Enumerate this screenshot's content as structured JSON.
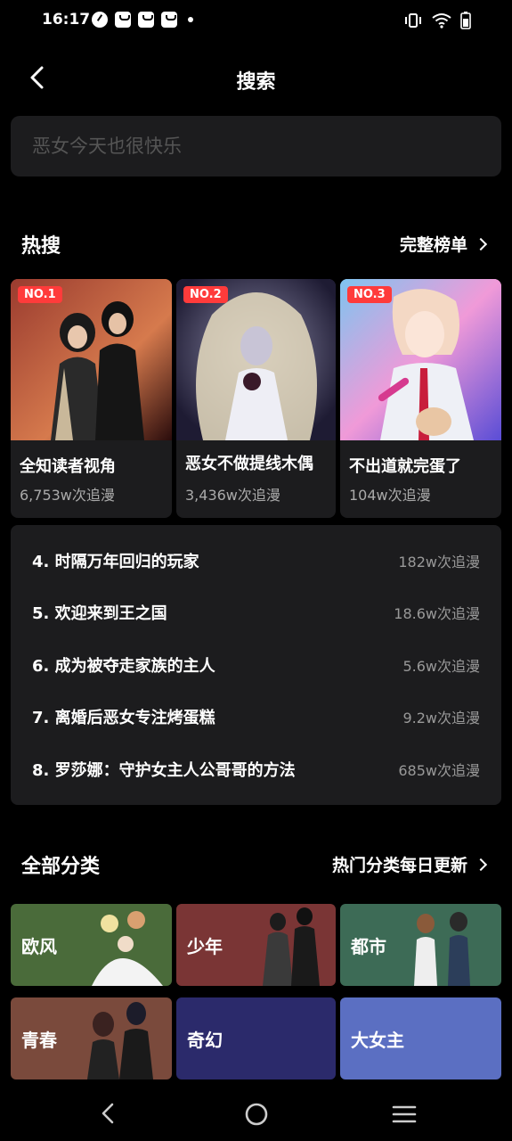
{
  "status": {
    "time": "16:17"
  },
  "header": {
    "title": "搜索"
  },
  "search": {
    "placeholder": "恶女今天也很快乐"
  },
  "hot": {
    "title": "热搜",
    "more": "完整榜单",
    "top": [
      {
        "rank": "NO.1",
        "name": "全知读者视角",
        "count": "6,753w次追漫"
      },
      {
        "rank": "NO.2",
        "name": "恶女不做提线木偶",
        "count": "3,436w次追漫"
      },
      {
        "rank": "NO.3",
        "name": "不出道就完蛋了",
        "count": "104w次追漫"
      }
    ],
    "list": [
      {
        "title": "4. 时隔万年回归的玩家",
        "count": "182w次追漫"
      },
      {
        "title": "5. 欢迎来到王之国",
        "count": "18.6w次追漫"
      },
      {
        "title": "6. 成为被夺走家族的主人",
        "count": "5.6w次追漫"
      },
      {
        "title": "7. 离婚后恶女专注烤蛋糕",
        "count": "9.2w次追漫"
      },
      {
        "title": "8. 罗莎娜：守护女主人公哥哥的方法",
        "count": "685w次追漫"
      }
    ]
  },
  "categories": {
    "title": "全部分类",
    "more": "热门分类每日更新",
    "items": [
      {
        "label": "欧风",
        "color": "#4a6b3a"
      },
      {
        "label": "少年",
        "color": "#7a3535"
      },
      {
        "label": "都市",
        "color": "#3d6b56"
      },
      {
        "label": "青春",
        "color": "#7a4a3c"
      },
      {
        "label": "奇幻",
        "color": "#2b2a6b"
      },
      {
        "label": "大女主",
        "color": "#5b6fc2"
      }
    ]
  }
}
